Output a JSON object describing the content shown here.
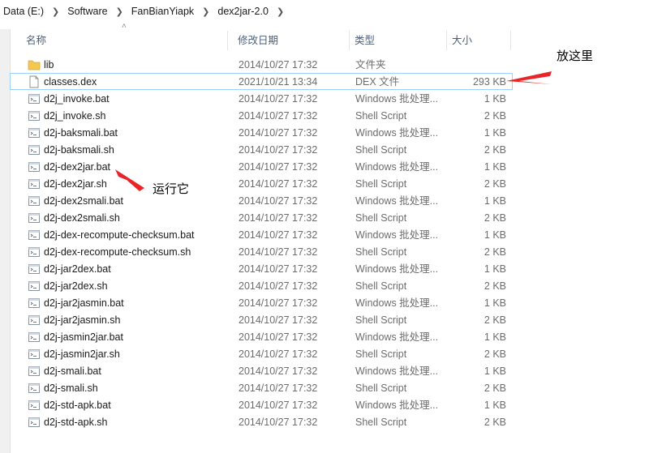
{
  "breadcrumb": [
    "Data (E:)",
    "Software",
    "FanBianYiapk",
    "dex2jar-2.0"
  ],
  "columns": {
    "name": "名称",
    "date": "修改日期",
    "type": "类型",
    "size": "大小"
  },
  "files": [
    {
      "name": "lib",
      "date": "2014/10/27 17:32",
      "type": "文件夹",
      "size": "",
      "icon": "folder-icon"
    },
    {
      "name": "classes.dex",
      "date": "2021/10/21 13:34",
      "type": "DEX 文件",
      "size": "293 KB",
      "icon": "file-icon"
    },
    {
      "name": "d2j_invoke.bat",
      "date": "2014/10/27 17:32",
      "type": "Windows 批处理...",
      "size": "1 KB",
      "icon": "script-icon"
    },
    {
      "name": "d2j_invoke.sh",
      "date": "2014/10/27 17:32",
      "type": "Shell Script",
      "size": "2 KB",
      "icon": "script-icon"
    },
    {
      "name": "d2j-baksmali.bat",
      "date": "2014/10/27 17:32",
      "type": "Windows 批处理...",
      "size": "1 KB",
      "icon": "script-icon"
    },
    {
      "name": "d2j-baksmali.sh",
      "date": "2014/10/27 17:32",
      "type": "Shell Script",
      "size": "2 KB",
      "icon": "script-icon"
    },
    {
      "name": "d2j-dex2jar.bat",
      "date": "2014/10/27 17:32",
      "type": "Windows 批处理...",
      "size": "1 KB",
      "icon": "script-icon"
    },
    {
      "name": "d2j-dex2jar.sh",
      "date": "2014/10/27 17:32",
      "type": "Shell Script",
      "size": "2 KB",
      "icon": "script-icon"
    },
    {
      "name": "d2j-dex2smali.bat",
      "date": "2014/10/27 17:32",
      "type": "Windows 批处理...",
      "size": "1 KB",
      "icon": "script-icon"
    },
    {
      "name": "d2j-dex2smali.sh",
      "date": "2014/10/27 17:32",
      "type": "Shell Script",
      "size": "2 KB",
      "icon": "script-icon"
    },
    {
      "name": "d2j-dex-recompute-checksum.bat",
      "date": "2014/10/27 17:32",
      "type": "Windows 批处理...",
      "size": "1 KB",
      "icon": "script-icon"
    },
    {
      "name": "d2j-dex-recompute-checksum.sh",
      "date": "2014/10/27 17:32",
      "type": "Shell Script",
      "size": "2 KB",
      "icon": "script-icon"
    },
    {
      "name": "d2j-jar2dex.bat",
      "date": "2014/10/27 17:32",
      "type": "Windows 批处理...",
      "size": "1 KB",
      "icon": "script-icon"
    },
    {
      "name": "d2j-jar2dex.sh",
      "date": "2014/10/27 17:32",
      "type": "Shell Script",
      "size": "2 KB",
      "icon": "script-icon"
    },
    {
      "name": "d2j-jar2jasmin.bat",
      "date": "2014/10/27 17:32",
      "type": "Windows 批处理...",
      "size": "1 KB",
      "icon": "script-icon"
    },
    {
      "name": "d2j-jar2jasmin.sh",
      "date": "2014/10/27 17:32",
      "type": "Shell Script",
      "size": "2 KB",
      "icon": "script-icon"
    },
    {
      "name": "d2j-jasmin2jar.bat",
      "date": "2014/10/27 17:32",
      "type": "Windows 批处理...",
      "size": "1 KB",
      "icon": "script-icon"
    },
    {
      "name": "d2j-jasmin2jar.sh",
      "date": "2014/10/27 17:32",
      "type": "Shell Script",
      "size": "2 KB",
      "icon": "script-icon"
    },
    {
      "name": "d2j-smali.bat",
      "date": "2014/10/27 17:32",
      "type": "Windows 批处理...",
      "size": "1 KB",
      "icon": "script-icon"
    },
    {
      "name": "d2j-smali.sh",
      "date": "2014/10/27 17:32",
      "type": "Shell Script",
      "size": "2 KB",
      "icon": "script-icon"
    },
    {
      "name": "d2j-std-apk.bat",
      "date": "2014/10/27 17:32",
      "type": "Windows 批处理...",
      "size": "1 KB",
      "icon": "script-icon"
    },
    {
      "name": "d2j-std-apk.sh",
      "date": "2014/10/27 17:32",
      "type": "Shell Script",
      "size": "2 KB",
      "icon": "script-icon"
    }
  ],
  "selected_file": "classes.dex",
  "annotations": {
    "place_here": "放这里",
    "run_it": "运行它"
  },
  "colors": {
    "arrow": "#e8262a",
    "selection_border": "#99d1ff",
    "header_text": "#4c607a",
    "folder": "#f4c84f"
  }
}
